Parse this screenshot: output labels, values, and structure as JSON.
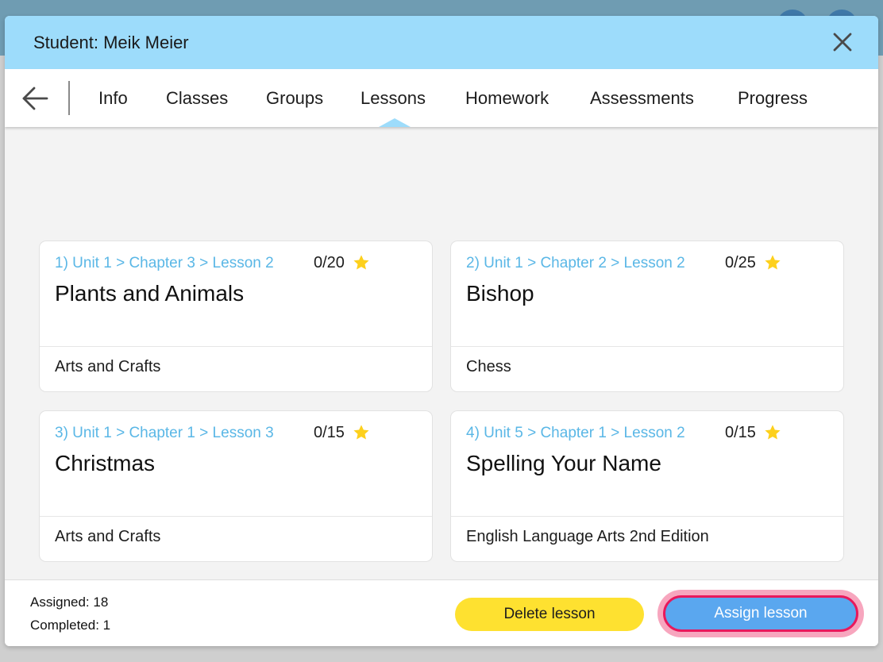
{
  "modal": {
    "title": "Student: Meik Meier"
  },
  "nav": {
    "tabs": [
      {
        "label": "Info"
      },
      {
        "label": "Classes"
      },
      {
        "label": "Groups"
      },
      {
        "label": "Lessons"
      },
      {
        "label": "Homework"
      },
      {
        "label": "Assessments"
      },
      {
        "label": "Progress"
      }
    ],
    "active_tab": "Lessons"
  },
  "lessons": [
    {
      "path": "1) Unit 1 > Chapter 3 > Lesson 2",
      "score": "0/20",
      "title": "Plants and Animals",
      "subject": "Arts and Crafts"
    },
    {
      "path": "2) Unit 1 > Chapter 2 > Lesson 2",
      "score": "0/25",
      "title": "Bishop",
      "subject": "Chess"
    },
    {
      "path": "3) Unit 1 > Chapter 1 > Lesson 3",
      "score": "0/15",
      "title": "Christmas",
      "subject": "Arts and Crafts"
    },
    {
      "path": "4) Unit 5 > Chapter 1 > Lesson 2",
      "score": "0/15",
      "title": "Spelling Your Name",
      "subject": "English Language Arts 2nd Edition"
    }
  ],
  "footer": {
    "assigned": "Assigned: 18",
    "completed": "Completed: 1",
    "delete_label": "Delete lesson",
    "assign_label": "Assign lesson"
  },
  "icons": {
    "close": "close-icon",
    "back": "arrow-left-icon",
    "star": "star-icon"
  },
  "colors": {
    "header": "#9ddcfb",
    "lesson_path": "#5ab7e6",
    "star": "#fdd01c",
    "delete_button": "#fee130",
    "assign_button": "#5aa7ef",
    "assign_highlight": "#e8195c"
  }
}
